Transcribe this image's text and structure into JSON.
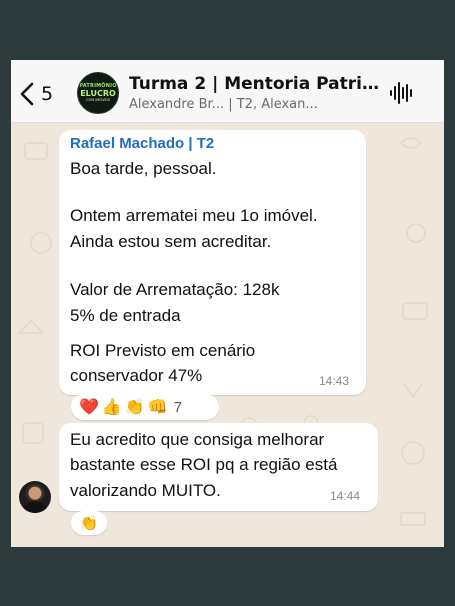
{
  "header": {
    "back_count": "5",
    "group_title": "Turma 2 | Mentoria Patrimô...",
    "group_members": "Alexandre Br... | T2, Alexan...",
    "avatar_logo_lines": [
      "PATRIMÔNIO",
      "ELUCRO",
      "COM IMÓVEIS"
    ]
  },
  "messages": [
    {
      "sender": "Rafael Machado | T2",
      "lines": [
        "Boa tarde, pessoal.",
        "",
        "Ontem arrematei meu 1o imóvel.",
        "Ainda estou sem acreditar.",
        "",
        "Valor de Arrematação: 128k",
        "5% de entrada",
        "ROI Previsto em cenário",
        "conservador 47%"
      ],
      "time": "14:43",
      "reactions": {
        "emojis": [
          "❤️",
          "👍",
          "👏",
          "👊"
        ],
        "count": "7"
      }
    },
    {
      "lines": [
        "Eu acredito que consiga melhorar",
        "bastante esse ROI pq a região está",
        "valorizando MUITO."
      ],
      "time": "14:44",
      "reactions": {
        "emojis": [
          "👏"
        ]
      }
    }
  ],
  "icons": {
    "back": "chevron-left-icon",
    "audio": "audio-waveform-icon"
  },
  "colors": {
    "sender_name": "#1f6fbf",
    "chat_background": "#efe7dc",
    "bubble": "#ffffff",
    "page_background": "#2c3a3b"
  }
}
